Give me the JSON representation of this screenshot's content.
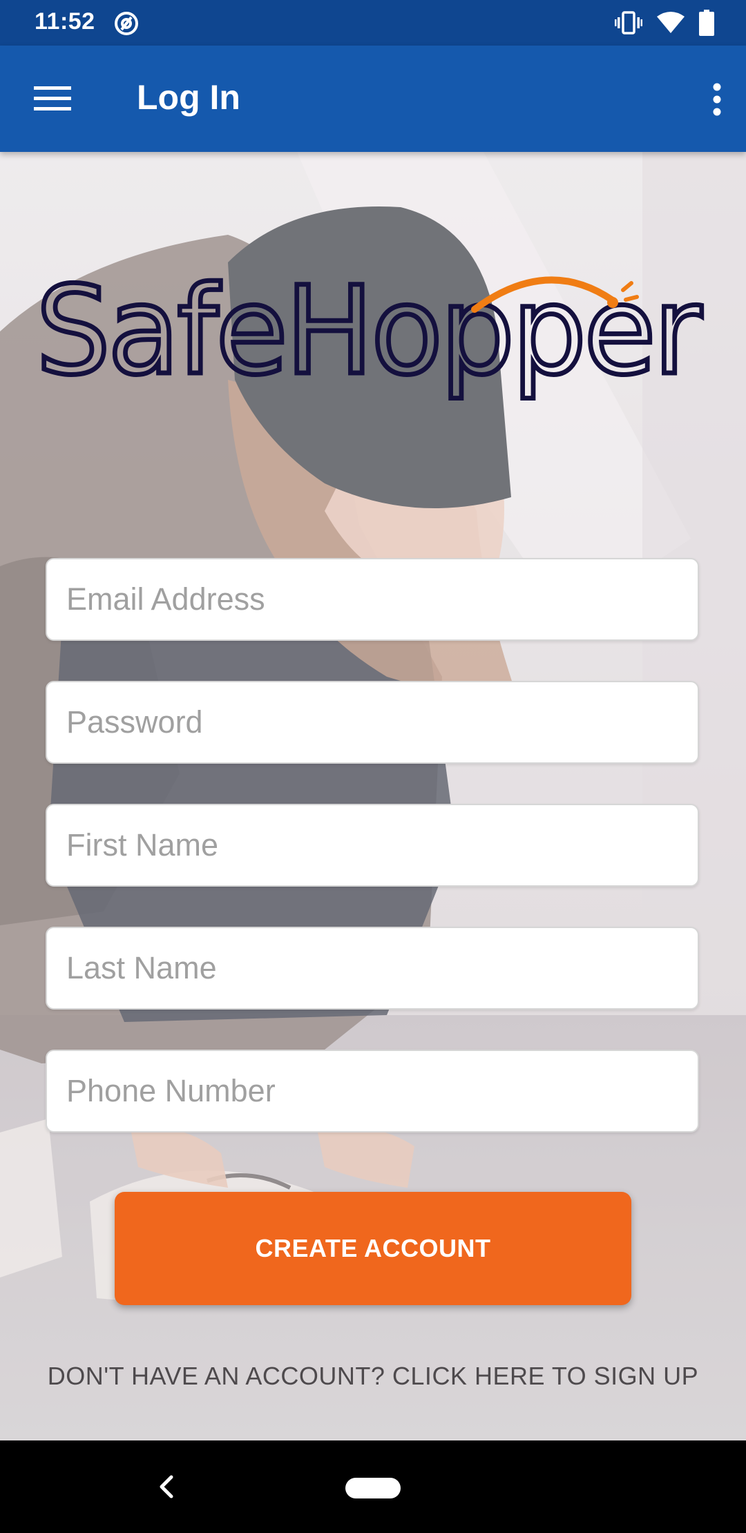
{
  "status_bar": {
    "time": "11:52",
    "left_icon": "at-sign-icon",
    "right_icons": [
      "vibrate-icon",
      "wifi-icon",
      "battery-icon"
    ]
  },
  "app_bar": {
    "title": "Log In",
    "menu_icon": "hamburger-menu-icon",
    "overflow_icon": "more-vertical-icon",
    "color": "#1559ad"
  },
  "logo": {
    "text": "SafeHopper",
    "dark_color": "#14103e",
    "accent_color": "#f07d14"
  },
  "form": {
    "email_placeholder": "Email Address",
    "password_placeholder": "Password",
    "first_name_placeholder": "First Name",
    "last_name_placeholder": "Last Name",
    "phone_placeholder": "Phone Number"
  },
  "create_button": {
    "label": "CREATE ACCOUNT",
    "color": "#f0671d"
  },
  "signup_link": {
    "label": "DON'T HAVE AN ACCOUNT? CLICK HERE TO SIGN UP"
  },
  "nav_bar": {
    "icons": [
      "back-icon",
      "home-pill-icon"
    ]
  }
}
